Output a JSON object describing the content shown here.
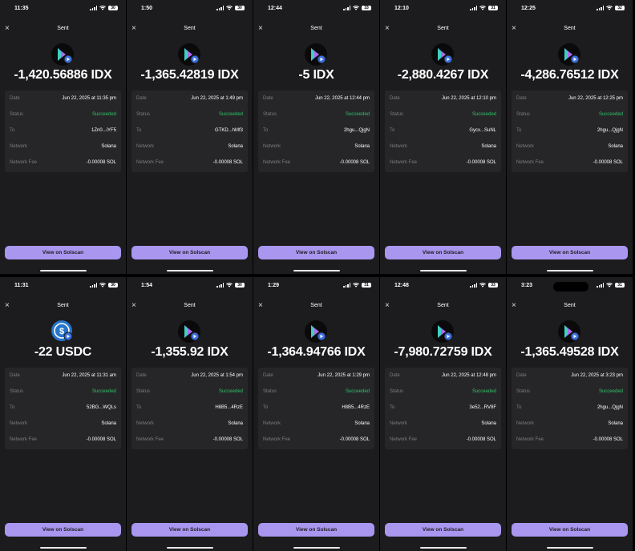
{
  "labels": {
    "close": "×",
    "title": "Sent",
    "date": "Date",
    "status": "Status",
    "to": "To",
    "network": "Network",
    "network_fee": "Network Fee",
    "button": "View on Solscan"
  },
  "colors": {
    "background": "#1c1c1e",
    "card": "#262628",
    "success": "#34c26a",
    "button": "#a896ef"
  },
  "screens": [
    {
      "time": "11:35",
      "battery": "30",
      "token": "idx",
      "amount": "-1,420.56886 IDX",
      "date": "Jun 22, 2025 at 11:35 pm",
      "status": "Succeeded",
      "to": "1Zn0...iYF5",
      "network": "Solana",
      "fee": "-0.00008 SOL"
    },
    {
      "time": "1:50",
      "battery": "30",
      "token": "idx",
      "amount": "-1,365.42819 IDX",
      "date": "Jun 22, 2025 at 1:49 pm",
      "status": "Succeeded",
      "to": "GTKD...hMf3",
      "network": "Solana",
      "fee": "-0.00008 SOL"
    },
    {
      "time": "12:44",
      "battery": "33",
      "token": "idx",
      "amount": "-5 IDX",
      "date": "Jun 22, 2025 at 12:44 pm",
      "status": "Succeeded",
      "to": "2hgu...QjgN",
      "network": "Solana",
      "fee": "-0.00008 SOL"
    },
    {
      "time": "12:10",
      "battery": "31",
      "token": "idx",
      "amount": "-2,880.4267 IDX",
      "date": "Jun 22, 2025 at 12:10 pm",
      "status": "Succeeded",
      "to": "Gycx...SuNL",
      "network": "Solana",
      "fee": "-0.00008 SOL"
    },
    {
      "time": "12:25",
      "battery": "32",
      "token": "idx",
      "amount": "-4,286.76512 IDX",
      "date": "Jun 22, 2025 at 12:25 pm",
      "status": "Succeeded",
      "to": "2hgu...QjgN",
      "network": "Solana",
      "fee": "-0.00008 SOL"
    },
    {
      "time": "11:31",
      "battery": "30",
      "token": "usdc",
      "amount": "-22 USDC",
      "date": "Jun 22, 2025 at 11:31 am",
      "status": "Succeeded",
      "to": "52BG...WQLs",
      "network": "Solana",
      "fee": "-0.00008 SOL"
    },
    {
      "time": "1:54",
      "battery": "30",
      "token": "idx",
      "amount": "-1,355.92 IDX",
      "date": "Jun 22, 2025 at 1:54 pm",
      "status": "Succeeded",
      "to": "H8B5...4RzE",
      "network": "Solana",
      "fee": "-0.00008 SOL"
    },
    {
      "time": "1:29",
      "battery": "31",
      "token": "idx",
      "amount": "-1,364.94766 IDX",
      "date": "Jun 22, 2025 at 1:29 pm",
      "status": "Succeeded",
      "to": "H8B5...4RzE",
      "network": "Solana",
      "fee": "-0.00008 SOL"
    },
    {
      "time": "12:48",
      "battery": "33",
      "token": "idx",
      "amount": "-7,980.72759 IDX",
      "date": "Jun 22, 2025 at 12:48 pm",
      "status": "Succeeded",
      "to": "3e52...RV8F",
      "network": "Solana",
      "fee": "-0.00008 SOL"
    },
    {
      "time": "3:23",
      "battery": "31",
      "token": "idx",
      "amount": "-1,365.49528 IDX",
      "date": "Jun 22, 2025 at 3:23 pm",
      "status": "Succeeded",
      "to": "2hgu...QjgN",
      "network": "Solana",
      "fee": "-0.00008 SOL",
      "island": true
    }
  ]
}
